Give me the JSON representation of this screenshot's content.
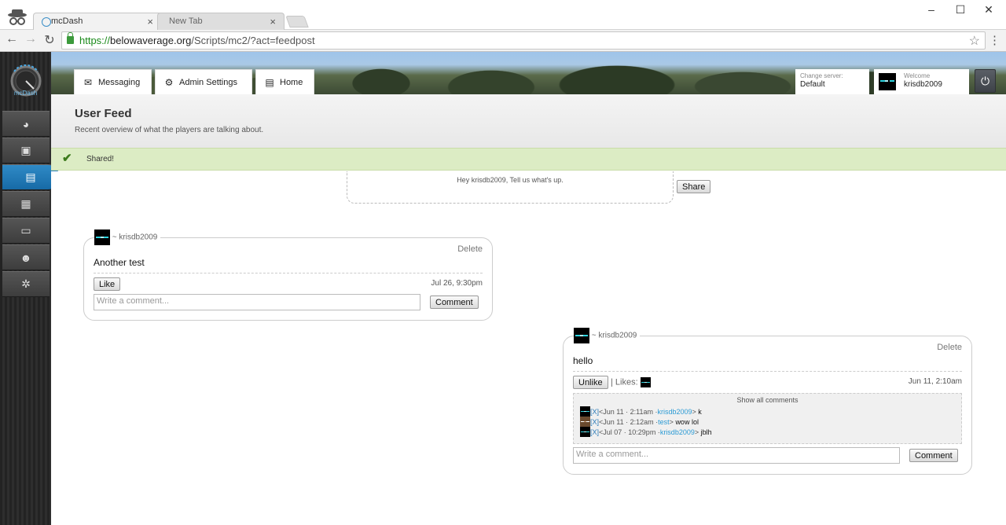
{
  "browser": {
    "tabs": [
      {
        "title": "mcDash",
        "active": true
      },
      {
        "title": "New Tab",
        "active": false
      }
    ],
    "url": {
      "scheme": "https://",
      "host": "belowaverage.org",
      "path": "/Scripts/mc2/?act=feedpost"
    },
    "window_controls": {
      "minimize": "–",
      "maximize": "☐",
      "close": "✕"
    }
  },
  "app": {
    "logo_text": "mcDash",
    "sidebar": [
      {
        "icon": "dashboard-icon",
        "active": false
      },
      {
        "icon": "image-icon",
        "active": false
      },
      {
        "icon": "feed-icon",
        "active": true
      },
      {
        "icon": "grid-icon",
        "active": false
      },
      {
        "icon": "chat-icon",
        "active": false
      },
      {
        "icon": "users-icon",
        "active": false
      },
      {
        "icon": "gear-icon",
        "active": false
      }
    ],
    "header_tabs": [
      {
        "label": "Messaging",
        "icon": "envelope-icon"
      },
      {
        "label": "Admin Settings",
        "icon": "gear-icon"
      },
      {
        "label": "Home",
        "icon": "document-icon"
      }
    ],
    "server": {
      "label": "Change server:",
      "value": "Default"
    },
    "welcome": {
      "label": "Welcome",
      "user": "krisdb2009"
    }
  },
  "page": {
    "title": "User Feed",
    "subtitle": "Recent overview of what the players are talking about."
  },
  "notice": {
    "message": "Shared!"
  },
  "share": {
    "placeholder": "Hey krisdb2009, Tell us what's up.",
    "button": "Share"
  },
  "posts": [
    {
      "author": "~ krisdb2009",
      "delete": "Delete",
      "text": "Another test",
      "like_button": "Like",
      "time": "Jul 26, 9:30pm",
      "comment_placeholder": "Write a comment...",
      "comment_button": "Comment"
    },
    {
      "author": "~ krisdb2009",
      "delete": "Delete",
      "text": "hello",
      "like_button": "Unlike",
      "likes_label": "| Likes:",
      "time": "Jun 11, 2:10am",
      "show_all": "Show all comments",
      "comments": [
        {
          "x": "[X]",
          "time": "<Jun 11 · 2:11am · ",
          "user": "krisdb2009",
          "end": ">",
          "text": "k",
          "avatar": "enderman"
        },
        {
          "x": "[X]",
          "time": "<Jun 11 · 2:12am · ",
          "user": "test",
          "end": ">",
          "text": "wow lol",
          "avatar": "steve"
        },
        {
          "x": "[X]",
          "time": "<Jul 07 · 10:29pm · ",
          "user": "krisdb2009",
          "end": ">",
          "text": "jblh",
          "avatar": "enderman"
        }
      ],
      "comment_placeholder": "Write a comment...",
      "comment_button": "Comment"
    }
  ],
  "colors": {
    "accent": "#1f78b6",
    "notice_bg": "#dcecc4",
    "link": "#2a9ad4"
  }
}
